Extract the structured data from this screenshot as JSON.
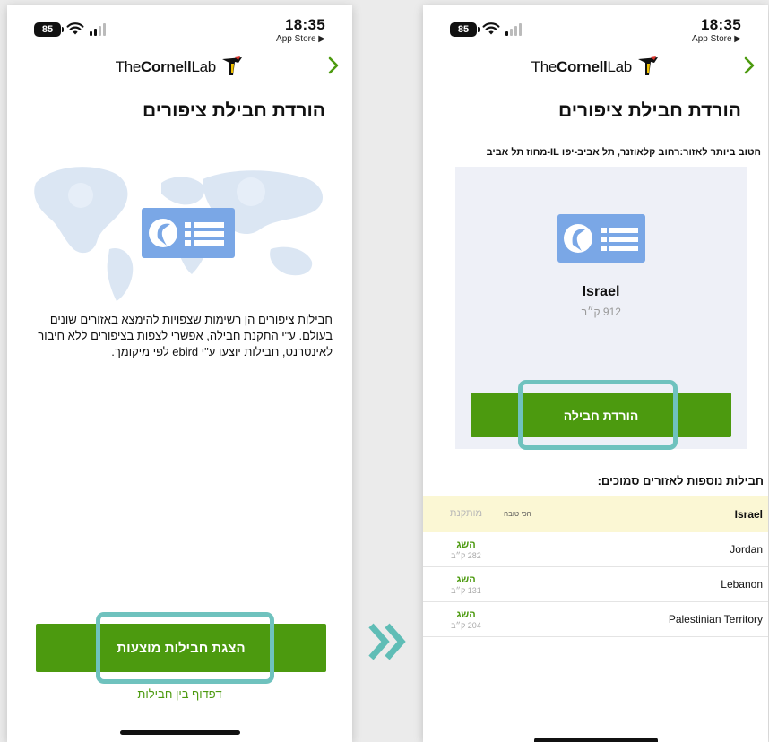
{
  "status_bar": {
    "battery": "85",
    "time": "18:35",
    "back_app": "App Store ▶"
  },
  "header": {
    "logo_the": "The",
    "logo_cornell": "Cornell",
    "logo_lab": "Lab",
    "next_icon": "chevron-right-icon"
  },
  "left_screen": {
    "title": "הורדת חבילת ציפורים",
    "description": "חבילות ציפורים הן רשימות שצפויות להימצא באזורים שונים בעולם. ע\"י התקנת חבילה, אפשרי לצפות בציפורים ללא חיבור לאינטרנט, חבילות יוצעו ע\"י ebird לפי מיקומך.",
    "primary_button": "הצגת חבילות מוצעות",
    "browse_link": "דפדוף בין חבילות"
  },
  "right_screen": {
    "title": "הורדת חבילת ציפורים",
    "best_region": "הטוב ביותר לאזור:רחוב קלאוזנר, תל אביב-יפו IL-מחוז תל אביב",
    "pack": {
      "name": "Israel",
      "size": "912 ק״ב",
      "download_button": "הורדת חבילה"
    },
    "nearby_title": "חבילות נוספות לאזורים סמוכים:",
    "rows": [
      {
        "country": "Israel",
        "best": "הכי טובה",
        "status": "מותקנת",
        "size": ""
      },
      {
        "country": "Jordan",
        "best": "",
        "status": "השג",
        "size": "282 ק״ב"
      },
      {
        "country": "Lebanon",
        "best": "",
        "status": "השג",
        "size": "131 ק״ב"
      },
      {
        "country": "Palestinian Territory",
        "best": "",
        "status": "השג",
        "size": "204 ק״ב"
      }
    ]
  },
  "colors": {
    "accent_green": "#4c9a0f",
    "highlight_teal": "#6fc2be",
    "pack_icon_blue": "#7aa7e6",
    "header_row_yellow": "#fbf7d4"
  }
}
